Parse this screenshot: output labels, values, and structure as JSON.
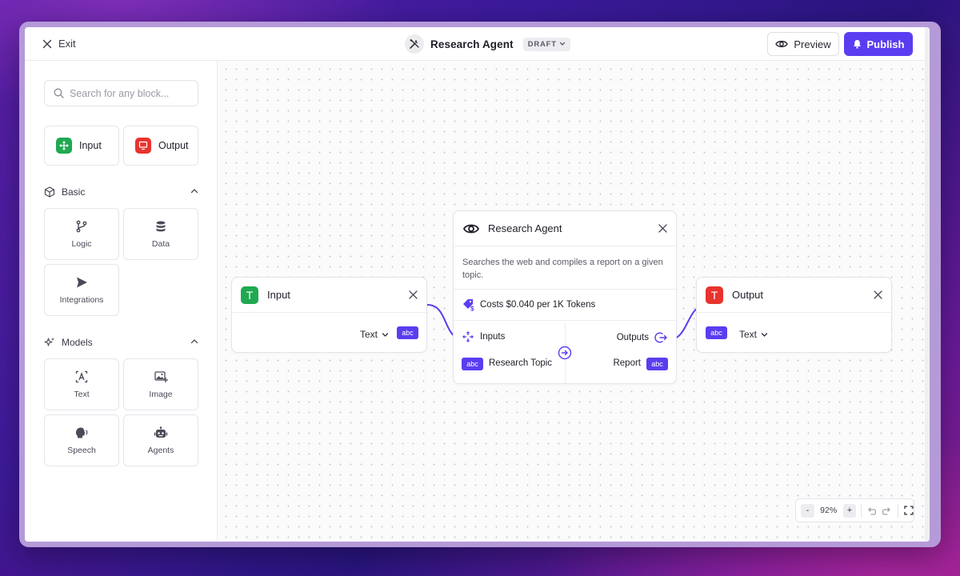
{
  "topbar": {
    "exit_label": "Exit",
    "title": "Research Agent",
    "status_badge": "DRAFT",
    "preview_label": "Preview",
    "publish_label": "Publish"
  },
  "sidebar": {
    "search_placeholder": "Search for any block...",
    "io_blocks": [
      {
        "label": "Input",
        "color": "#1fa950",
        "icon": "input-move-icon"
      },
      {
        "label": "Output",
        "color": "#e8332e",
        "icon": "monitor-icon"
      }
    ],
    "sections": [
      {
        "label": "Basic",
        "icon": "cube-icon",
        "items": [
          {
            "label": "Logic",
            "icon": "git-branch-icon"
          },
          {
            "label": "Data",
            "icon": "database-icon"
          },
          {
            "label": "Integrations",
            "icon": "send-icon"
          }
        ]
      },
      {
        "label": "Models",
        "icon": "sparkles-icon",
        "items": [
          {
            "label": "Text",
            "icon": "text-model-icon"
          },
          {
            "label": "Image",
            "icon": "image-plus-icon"
          },
          {
            "label": "Speech",
            "icon": "speech-icon"
          },
          {
            "label": "Agents",
            "icon": "robot-icon"
          }
        ]
      }
    ]
  },
  "nodes": {
    "input": {
      "letter": "T",
      "title": "Input",
      "type_label": "Text",
      "handle": "abc",
      "color": "#1fa950"
    },
    "agent": {
      "title": "Research Agent",
      "description": "Searches the web and compiles a report on a given topic.",
      "cost": "Costs $0.040 per 1K Tokens",
      "inputs_label": "Inputs",
      "outputs_label": "Outputs",
      "input_field": "Research Topic",
      "output_field": "Report",
      "handle": "abc"
    },
    "output": {
      "letter": "T",
      "title": "Output",
      "type_label": "Text",
      "handle": "abc",
      "color": "#e8332e"
    }
  },
  "zoom": {
    "minus": "-",
    "level": "92%",
    "plus": "+"
  },
  "colors": {
    "accent": "#5a3df0",
    "input_green": "#1fa950",
    "output_red": "#e8332e"
  }
}
